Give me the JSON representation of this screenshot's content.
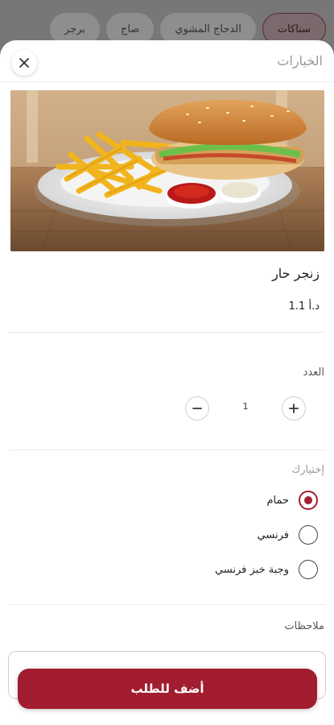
{
  "categories": [
    {
      "label": "سناكات",
      "active": true
    },
    {
      "label": "الدجاج المشوي",
      "active": false
    },
    {
      "label": "صاج",
      "active": false
    },
    {
      "label": "برجر",
      "active": false
    }
  ],
  "sheet": {
    "title": "الخيارات",
    "close_icon": "close-icon"
  },
  "item": {
    "name": "زنجر حار",
    "price": "1.1 د.أ"
  },
  "quantity": {
    "label": "العدد",
    "value": "1"
  },
  "options": {
    "label": "إختيارك",
    "items": [
      {
        "label": "حمام",
        "checked": true
      },
      {
        "label": "فرنسي",
        "checked": false
      },
      {
        "label": "وجبة خبز فرنسي",
        "checked": false
      }
    ]
  },
  "notes": {
    "label": "ملاحظات",
    "placeholder": ""
  },
  "add_button": {
    "label": "أضف للطلب"
  },
  "colors": {
    "accent": "#a21d2f",
    "sheet_bg": "#ffffff",
    "overlay": "#8a8a8a"
  }
}
